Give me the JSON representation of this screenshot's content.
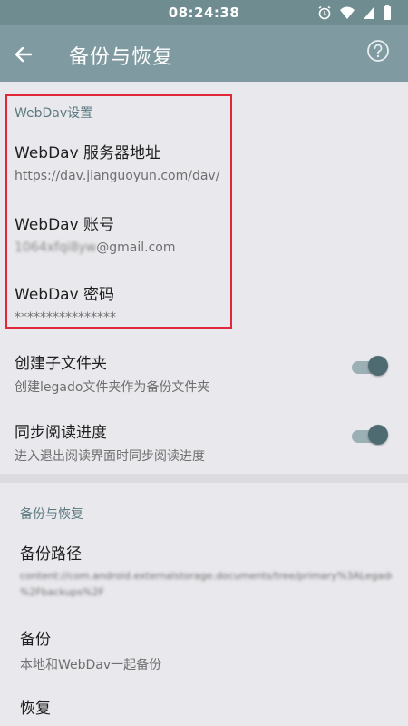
{
  "status": {
    "time": "08:24:38"
  },
  "appbar": {
    "title": "备份与恢复"
  },
  "webdav": {
    "section_title": "WebDav设置",
    "server": {
      "title": "WebDav 服务器地址",
      "value": "https://dav.jianguoyun.com/dav/"
    },
    "account": {
      "title": "WebDav 账号",
      "value_masked": "1064xfqi8yw",
      "value_suffix": "@gmail.com"
    },
    "password": {
      "title": "WebDav 密码",
      "value": "****************"
    }
  },
  "options": {
    "subfolder": {
      "title": "创建子文件夹",
      "summary": "创建legado文件夹作为备份文件夹",
      "enabled": true
    },
    "sync_progress": {
      "title": "同步阅读进度",
      "summary": "进入退出阅读界面时同步阅读进度",
      "enabled": true
    }
  },
  "backup": {
    "section_title": "备份与恢复",
    "path": {
      "title": "备份路径",
      "value_line1": "content://com.android.externalstorage.documents/tree/primary%3ALegado",
      "value_line2": "%2Fbackups%2F"
    },
    "backup_item": {
      "title": "备份",
      "summary": "本地和WebDav一起备份"
    },
    "restore_item": {
      "title": "恢复"
    }
  },
  "colors": {
    "appbar": "#7f9aa0",
    "statusbar": "#6f8c90",
    "accent": "#4d6b70",
    "highlight_box": "#e0283a"
  }
}
